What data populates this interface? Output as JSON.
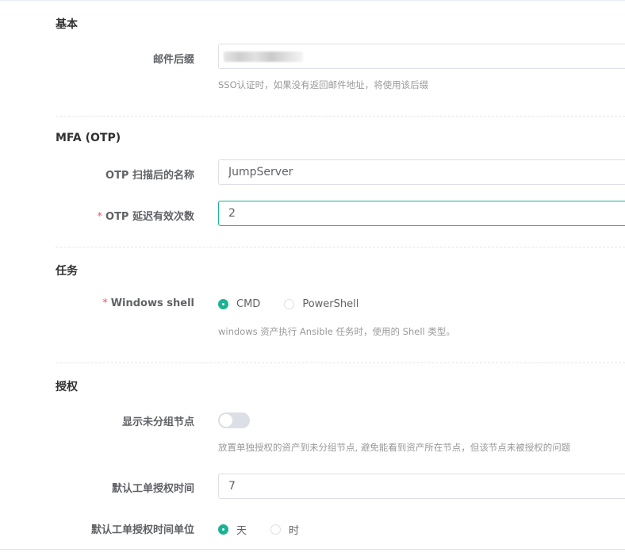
{
  "basic": {
    "title": "基本",
    "email_suffix": {
      "label": "邮件后缀",
      "help": "SSO认证时，如果没有返回邮件地址，将使用该后缀"
    }
  },
  "mfa": {
    "title": "MFA (OTP)",
    "otp_issuer": {
      "label": "OTP 扫描后的名称",
      "value": "JumpServer"
    },
    "otp_valid_window": {
      "required": "*",
      "label": "OTP 延迟有效次数",
      "value": "2"
    }
  },
  "task": {
    "title": "任务",
    "windows_shell": {
      "required": "*",
      "label": "Windows shell",
      "options": [
        {
          "label": "CMD",
          "checked": true
        },
        {
          "label": "PowerShell",
          "checked": false
        }
      ],
      "help": "windows 资产执行 Ansible 任务时，使用的 Shell 类型。"
    }
  },
  "auth": {
    "title": "授权",
    "show_ungroup_node": {
      "label": "显示未分组节点",
      "enabled": false,
      "help": "放置单独授权的资产到未分组节点, 避免能看到资产所在节点，但该节点未被授权的问题"
    },
    "ticket_auth_time": {
      "label": "默认工单授权时间",
      "value": "7"
    },
    "ticket_auth_unit": {
      "label": "默认工单授权时间单位",
      "options": [
        {
          "label": "天",
          "checked": true
        },
        {
          "label": "时",
          "checked": false
        }
      ]
    }
  },
  "colors": {
    "accent": "#1ab394",
    "required": "#ed5565",
    "border": "#dcdfe6"
  }
}
